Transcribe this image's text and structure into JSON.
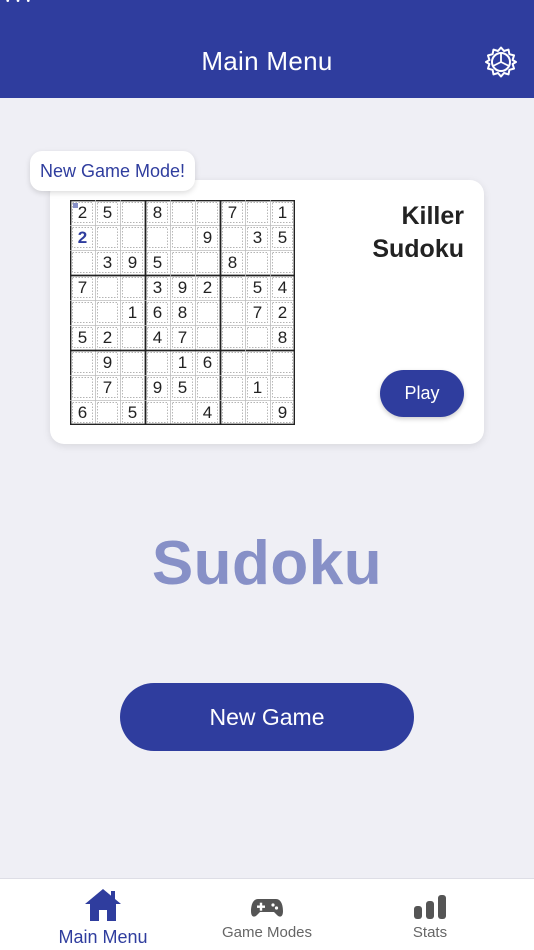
{
  "header": {
    "title": "Main Menu",
    "settings_icon": "gear-icon"
  },
  "featured": {
    "badge": "New Game Mode!",
    "mode_title_line1": "Killer",
    "mode_title_line2": "Sudoku",
    "play_label": "Play",
    "preview_grid": [
      [
        "2",
        "5",
        "",
        "8",
        "",
        "",
        "7",
        "",
        "1"
      ],
      [
        "2",
        "",
        "",
        "",
        "",
        "9",
        "",
        "3",
        "5"
      ],
      [
        "",
        "3",
        "9",
        "5",
        "",
        "",
        "8",
        "",
        ""
      ],
      [
        "7",
        "",
        "",
        "3",
        "9",
        "2",
        "",
        "5",
        "4"
      ],
      [
        "",
        "",
        "1",
        "6",
        "8",
        "",
        "",
        "7",
        "2"
      ],
      [
        "5",
        "2",
        "",
        "4",
        "7",
        "",
        "",
        "",
        "8"
      ],
      [
        "",
        "9",
        "",
        "",
        "1",
        "6",
        "",
        "",
        ""
      ],
      [
        "",
        "7",
        "",
        "9",
        "5",
        "",
        "",
        "1",
        ""
      ],
      [
        "6",
        "",
        "5",
        "",
        "",
        "4",
        "",
        "",
        "9"
      ]
    ]
  },
  "logo": "Sudoku",
  "new_game_label": "New Game",
  "tabs": [
    {
      "label": "Main Menu",
      "icon": "home-icon",
      "active": true
    },
    {
      "label": "Game Modes",
      "icon": "gamepad-icon",
      "active": false
    },
    {
      "label": "Stats",
      "icon": "bar-chart-icon",
      "active": false
    }
  ],
  "colors": {
    "brand": "#2f3d9e",
    "logo": "#8790c7",
    "background": "#efeff5"
  }
}
